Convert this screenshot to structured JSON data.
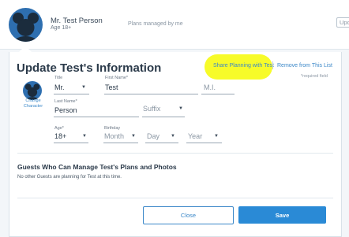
{
  "header": {
    "name": "Mr. Test Person",
    "age": "Age 18+",
    "plans_text": "Plans managed by me",
    "update_label": "Update"
  },
  "form": {
    "title": "Update Test's Information",
    "share_link": "Share Planning with Test",
    "remove_link": "Remove from This List",
    "required_note": "*required field",
    "change_character": "Change Character",
    "title_field": {
      "label": "Title",
      "value": "Mr."
    },
    "first_name": {
      "label": "First Name*",
      "value": "Test"
    },
    "middle_initial": {
      "placeholder": "M.I."
    },
    "last_name": {
      "label": "Last Name*",
      "value": "Person"
    },
    "suffix": {
      "placeholder": "Suffix"
    },
    "age": {
      "label": "Age*",
      "value": "18+"
    },
    "birthday": {
      "label": "Birthday",
      "month": "Month",
      "day": "Day",
      "year": "Year"
    }
  },
  "guests": {
    "title": "Guests Who Can Manage Test's Plans and Photos",
    "text": "No other Guests are planning for Test at this time."
  },
  "actions": {
    "close": "Close",
    "save": "Save"
  },
  "colors": {
    "accent": "#2a8ad6",
    "link": "#3a87c8",
    "highlight": "#f7fb1e",
    "avatar": "#2e6fb0"
  },
  "icons": {
    "avatar": "mickey-silhouette-icon",
    "caret": "chevron-down-icon"
  }
}
